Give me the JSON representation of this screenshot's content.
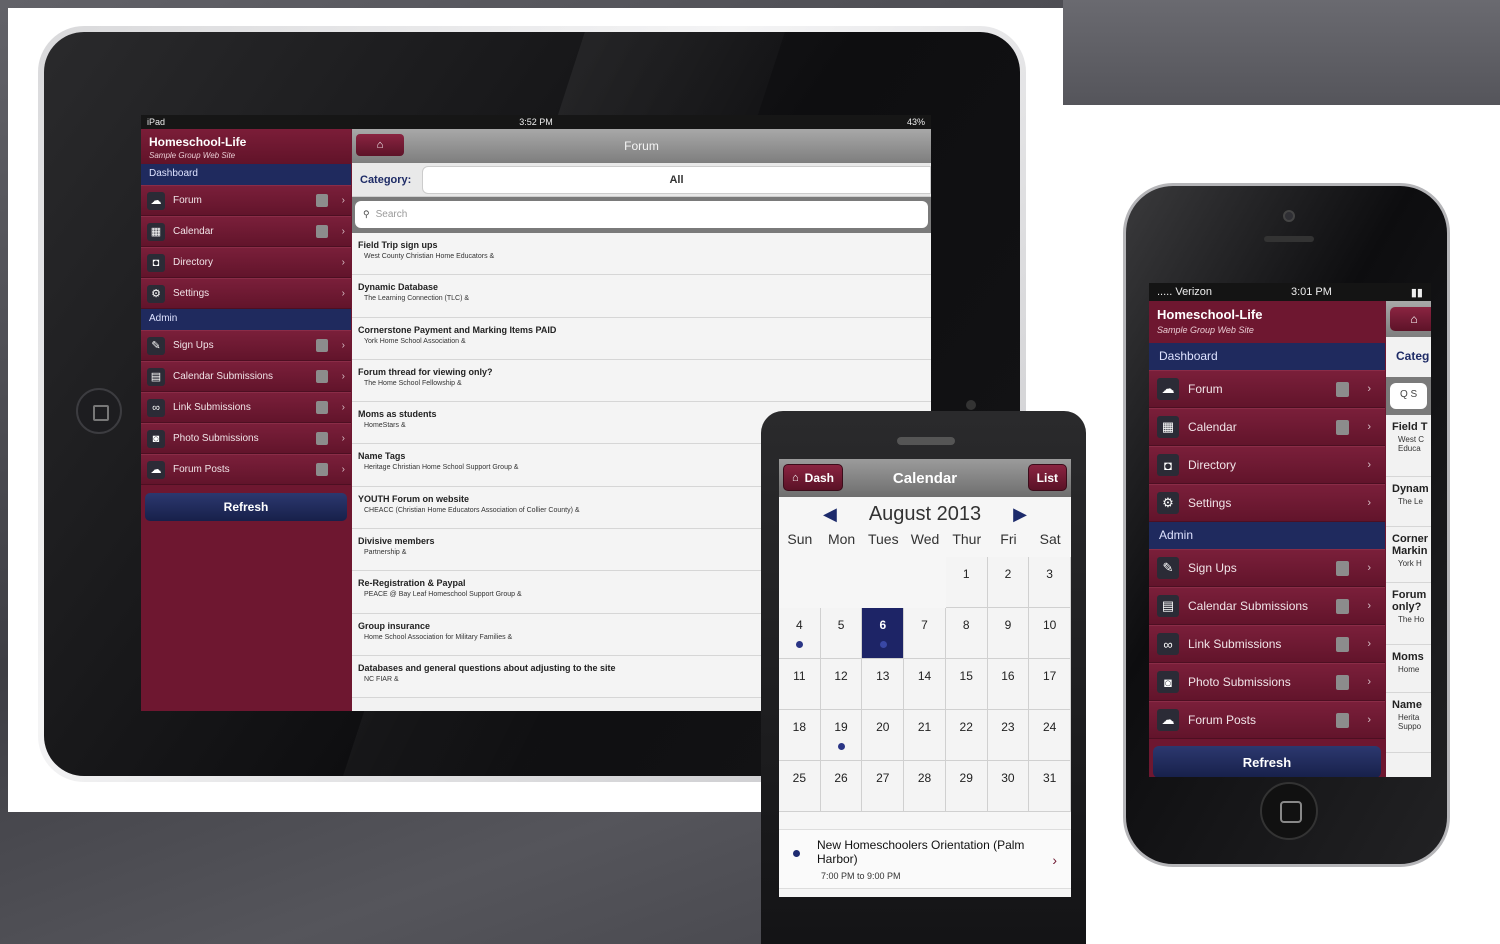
{
  "ipad": {
    "status": {
      "device": "iPad",
      "time": "3:52 PM",
      "battery": "43%"
    },
    "app": {
      "title": "Homeschool-Life",
      "subtitle": "Sample Group Web Site"
    },
    "sections": [
      {
        "label": "Dashboard",
        "items": [
          {
            "label": "Forum",
            "icon": "forum-icon",
            "glyph": "☁",
            "badge": true
          },
          {
            "label": "Calendar",
            "icon": "calendar-icon",
            "glyph": "▦",
            "badge": true
          },
          {
            "label": "Directory",
            "icon": "directory-icon",
            "glyph": "◘",
            "badge": false
          },
          {
            "label": "Settings",
            "icon": "settings-icon",
            "glyph": "⚙",
            "badge": false
          }
        ]
      },
      {
        "label": "Admin",
        "items": [
          {
            "label": "Sign Ups",
            "icon": "signups-icon",
            "glyph": "✎",
            "badge": true
          },
          {
            "label": "Calendar Submissions",
            "icon": "calendar-submissions-icon",
            "glyph": "▤",
            "badge": true
          },
          {
            "label": "Link Submissions",
            "icon": "link-icon",
            "glyph": "∞",
            "badge": true
          },
          {
            "label": "Photo Submissions",
            "icon": "photo-icon",
            "glyph": "◙",
            "badge": true
          },
          {
            "label": "Forum Posts",
            "icon": "forum-posts-icon",
            "glyph": "☁",
            "badge": true
          }
        ]
      }
    ],
    "refresh_label": "Refresh",
    "main": {
      "home_glyph": "⌂",
      "title": "Forum",
      "category_label": "Category:",
      "category_value": "All",
      "search_placeholder": "Search",
      "threads": [
        {
          "title": "Field Trip sign ups",
          "group": "West County Christian Home Educators &"
        },
        {
          "title": "Dynamic Database",
          "group": "The Learning Connection (TLC) &"
        },
        {
          "title": "Cornerstone Payment and Marking Items PAID",
          "group": "York Home School Association &"
        },
        {
          "title": "Forum thread for viewing only?",
          "group": "The Home School Fellowship &"
        },
        {
          "title": "Moms as students",
          "group": "HomeStars &"
        },
        {
          "title": "Name Tags",
          "group": "Heritage Christian Home School Support Group &"
        },
        {
          "title": "YOUTH Forum on website",
          "group": "CHEACC (Christian Home Educators Association of Collier County) &"
        },
        {
          "title": "Divisive members",
          "group": "Partnership &"
        },
        {
          "title": "Re-Registration & Paypal",
          "group": "PEACE @ Bay Leaf Homeschool Support Group &"
        },
        {
          "title": "Group insurance",
          "group": "Home School Association for Military Families &"
        },
        {
          "title": "Databases and general questions about adjusting to the site",
          "group": "NC FIAR &"
        }
      ]
    }
  },
  "android": {
    "dash_label": "Dash",
    "title": "Calendar",
    "list_label": "List",
    "month": "August 2013",
    "prev_glyph": "◀",
    "next_glyph": "▶",
    "weekdays": [
      "Sun",
      "Mon",
      "Tues",
      "Wed",
      "Thur",
      "Fri",
      "Sat"
    ],
    "leading_blanks": 4,
    "days_in_month": 31,
    "today": 6,
    "event_days": [
      4,
      6,
      19
    ],
    "event": {
      "title": "New Homeschoolers Orientation (Palm Harbor)",
      "time": "7:00 PM to 9:00 PM"
    }
  },
  "iphone": {
    "status": {
      "carrier": "..... Verizon",
      "time": "3:01 PM"
    },
    "app": {
      "title": "Homeschool-Life",
      "subtitle": "Sample Group Web Site"
    },
    "sections": [
      {
        "label": "Dashboard",
        "items": [
          {
            "label": "Forum",
            "icon": "forum-icon",
            "glyph": "☁",
            "badge": true
          },
          {
            "label": "Calendar",
            "icon": "calendar-icon",
            "glyph": "▦",
            "badge": true
          },
          {
            "label": "Directory",
            "icon": "directory-icon",
            "glyph": "◘",
            "badge": false
          },
          {
            "label": "Settings",
            "icon": "settings-icon",
            "glyph": "⚙",
            "badge": false
          }
        ]
      },
      {
        "label": "Admin",
        "items": [
          {
            "label": "Sign Ups",
            "icon": "signups-icon",
            "glyph": "✎",
            "badge": true
          },
          {
            "label": "Calendar Submissions",
            "icon": "calendar-submissions-icon",
            "glyph": "▤",
            "badge": true
          },
          {
            "label": "Link Submissions",
            "icon": "link-icon",
            "glyph": "∞",
            "badge": true
          },
          {
            "label": "Photo Submissions",
            "icon": "photo-icon",
            "glyph": "◙",
            "badge": true
          },
          {
            "label": "Forum Posts",
            "icon": "forum-posts-icon",
            "glyph": "☁",
            "badge": true
          }
        ]
      }
    ],
    "refresh_label": "Refresh",
    "main": {
      "home_glyph": "⌂",
      "category_label": "Categ",
      "search_text": "Q  S",
      "threads": [
        {
          "title": "Field T",
          "group": "West C Educa"
        },
        {
          "title": "Dynam",
          "group": "The Le"
        },
        {
          "title": "Corner Markin",
          "group": "York H"
        },
        {
          "title": "Forum only?",
          "group": "The Ho"
        },
        {
          "title": "Moms",
          "group": "Home"
        },
        {
          "title": "Name",
          "group": "Herita Suppo"
        }
      ]
    }
  },
  "colors": {
    "maroon": "#6e1730",
    "navy": "#1f2a5e",
    "today": "#1d2466"
  }
}
